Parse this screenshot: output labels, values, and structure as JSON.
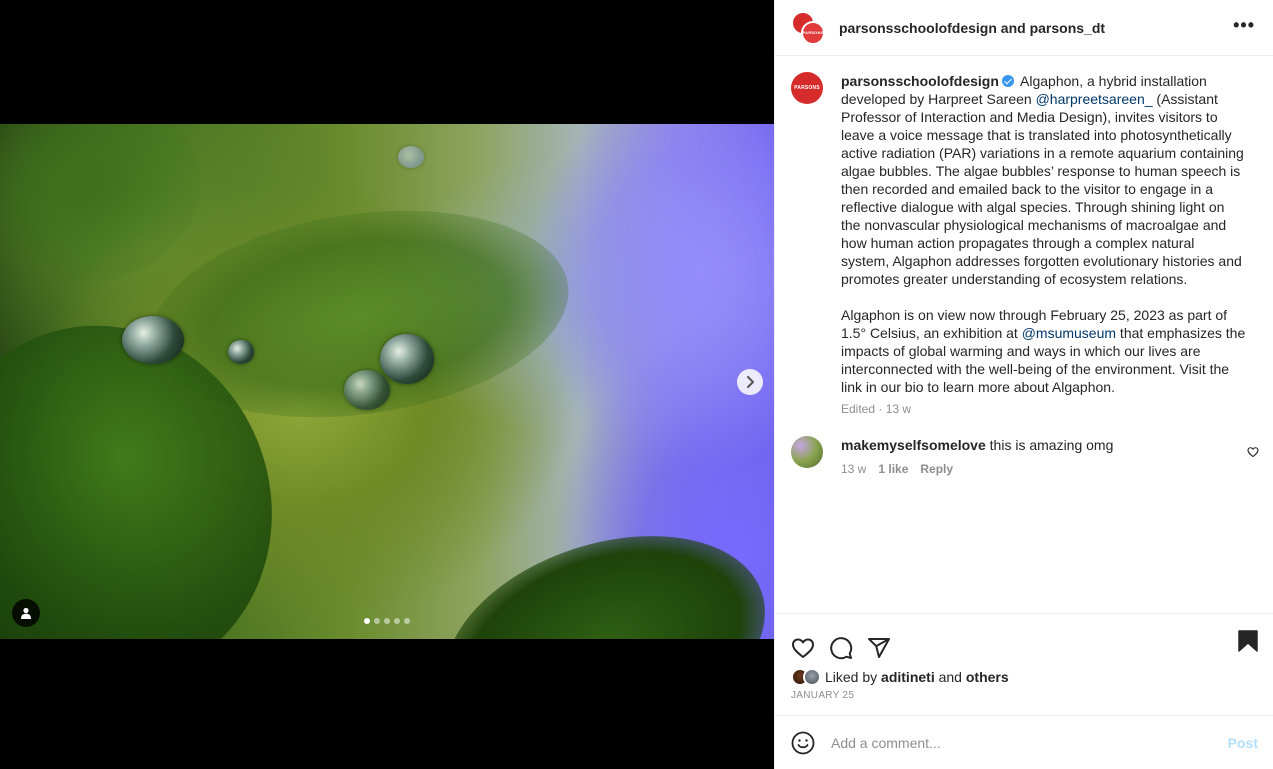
{
  "media": {
    "slide_count": 5,
    "active_slide": 1,
    "next_icon": "chevron-right-icon",
    "tag_icon": "user-tag-icon"
  },
  "header": {
    "title": "parsonsschoolofdesign and parsons_dt",
    "avatar_text": "PARSONS",
    "more_icon": "more-horizontal-icon",
    "more_label": "•••"
  },
  "caption": {
    "avatar_text": "PARSONS",
    "username": "parsonsschoolofdesign",
    "verified": true,
    "text_1a": " Algaphon, a hybrid installation developed by Harpreet Sareen ",
    "mention_1": "@harpreetsareen_",
    "text_1b": " (Assistant Professor of Interaction and Media Design), invites visitors to leave a voice message that is translated into photosynthetically active radiation (PAR) variations in a remote aquarium containing algae bubbles. The algae bubbles’ response to human speech is then recorded and emailed back to the visitor to engage in a reflective dialogue with algal species. Through shining light on the nonvascular physiological mechanisms of macroalgae and how human action propagates through a complex natural system, Algaphon addresses forgotten evolutionary histories and promotes greater understanding of ecosystem relations.",
    "text_2a": "Algaphon is on view now through February 25, 2023 as part of 1.5° Celsius, an exhibition at ",
    "mention_2": "@msumuseum",
    "text_2b": " that emphasizes the impacts of global warming and ways in which our lives are interconnected with the well-being of the environment. Visit the link in our bio to learn more about Algaphon.",
    "meta": "Edited · 13 w"
  },
  "comment": {
    "username": "makemyselfsomelove",
    "text": " this is amazing omg",
    "time": "13 w",
    "likes": "1 like",
    "reply": "Reply"
  },
  "actions": {
    "like_icon": "heart-icon",
    "comment_icon": "comment-icon",
    "share_icon": "send-icon",
    "save_icon": "bookmark-icon"
  },
  "likes": {
    "prefix": "Liked by ",
    "user": "aditineti",
    "middle": " and ",
    "others": "others"
  },
  "date": "JANUARY 25",
  "add_comment": {
    "placeholder": "Add a comment...",
    "post_label": "Post"
  },
  "colors": {
    "link": "#00376b",
    "verified": "#3897f0",
    "post_disabled": "#b2dffc",
    "muted": "#8e8e8e"
  }
}
